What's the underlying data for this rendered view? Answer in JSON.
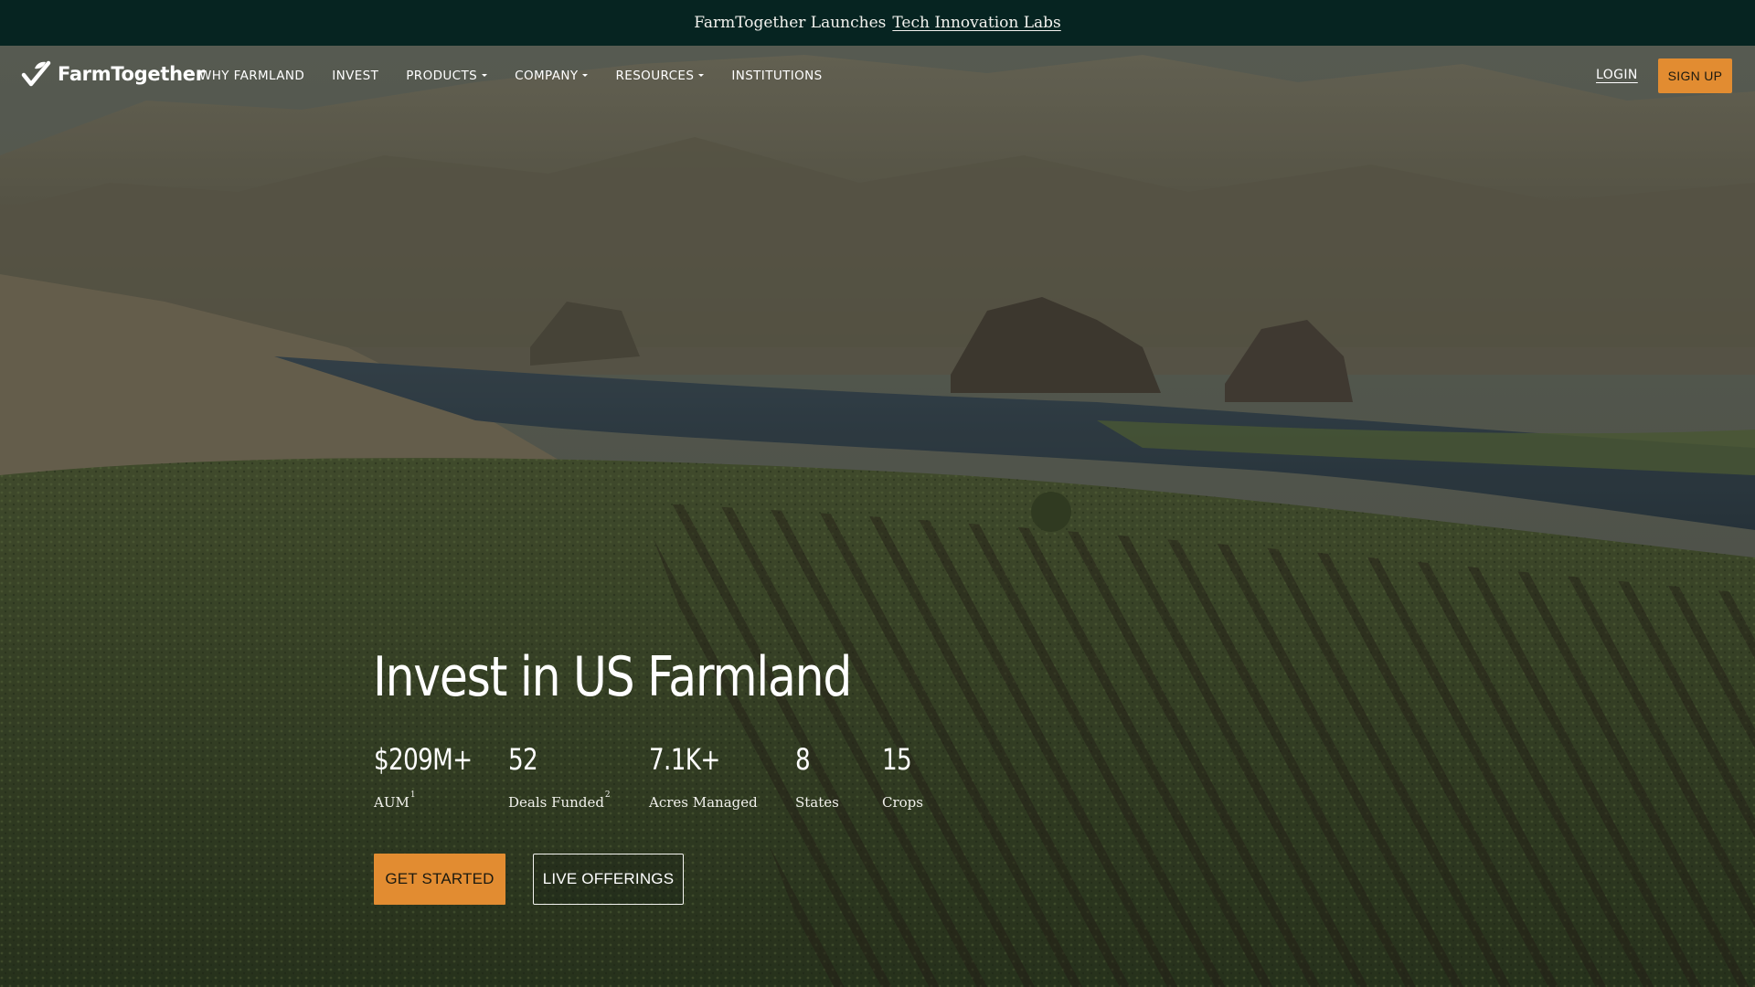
{
  "announcement": {
    "text": "FarmTogether Launches",
    "link": "Tech Innovation Labs"
  },
  "brand": {
    "name": "FarmTogether",
    "logo_icon": "sprout-check-icon",
    "accent_color": "#e28c31",
    "dark_color": "#062421"
  },
  "nav": {
    "items": [
      {
        "label": "WHY FARMLAND",
        "has_dropdown": false
      },
      {
        "label": "INVEST",
        "has_dropdown": false
      },
      {
        "label": "PRODUCTS",
        "has_dropdown": true
      },
      {
        "label": "COMPANY",
        "has_dropdown": true
      },
      {
        "label": "RESOURCES",
        "has_dropdown": true
      },
      {
        "label": "INSTITUTIONS",
        "has_dropdown": false
      }
    ],
    "login": "LOGIN",
    "signup": "SIGN UP"
  },
  "hero": {
    "headline": "Invest in US Farmland",
    "stats": [
      {
        "value": "$209M+",
        "label": "AUM",
        "footnote": "1"
      },
      {
        "value": "52",
        "label": "Deals Funded",
        "footnote": "2"
      },
      {
        "value": "7.1K+",
        "label": "Acres Managed",
        "footnote": ""
      },
      {
        "value": "8",
        "label": "States",
        "footnote": ""
      },
      {
        "value": "15",
        "label": "Crops",
        "footnote": ""
      }
    ],
    "cta_primary": "GET STARTED",
    "cta_secondary": "LIVE OFFERINGS"
  }
}
